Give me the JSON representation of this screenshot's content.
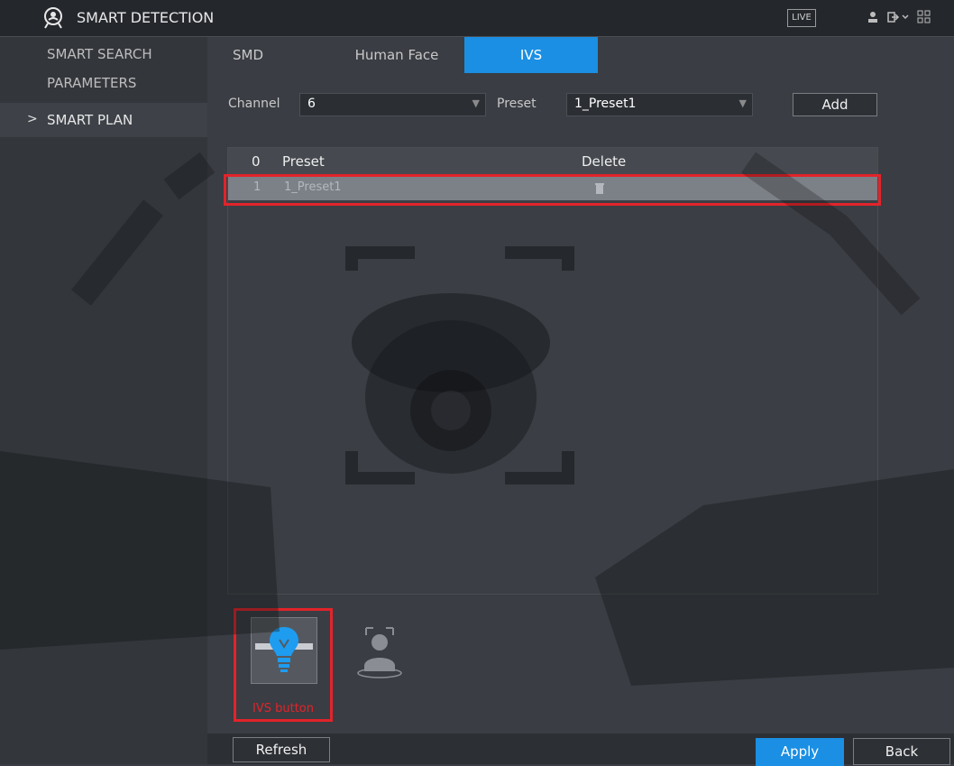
{
  "header": {
    "title": "SMART DETECTION",
    "live_label": "LIVE"
  },
  "sidebar": {
    "items": [
      {
        "label": "SMART SEARCH"
      },
      {
        "label": "PARAMETERS"
      },
      {
        "label": "SMART PLAN",
        "active": true
      }
    ]
  },
  "tabs": [
    {
      "label": "SMD"
    },
    {
      "label": "Human Face"
    },
    {
      "label": "IVS",
      "active": true
    }
  ],
  "form": {
    "channel_label": "Channel",
    "channel_value": "6",
    "preset_label": "Preset",
    "preset_value": "1_Preset1",
    "add_label": "Add"
  },
  "table": {
    "headers": {
      "index": "0",
      "preset": "Preset",
      "delete": "Delete"
    },
    "rows": [
      {
        "index": "1",
        "preset": "1_Preset1"
      }
    ]
  },
  "ivs_caption": "IVS button",
  "buttons": {
    "refresh": "Refresh",
    "apply": "Apply",
    "back": "Back"
  },
  "colors": {
    "accent": "#1a8fe3",
    "highlight": "#e2242a",
    "background": "#3a3d43"
  }
}
